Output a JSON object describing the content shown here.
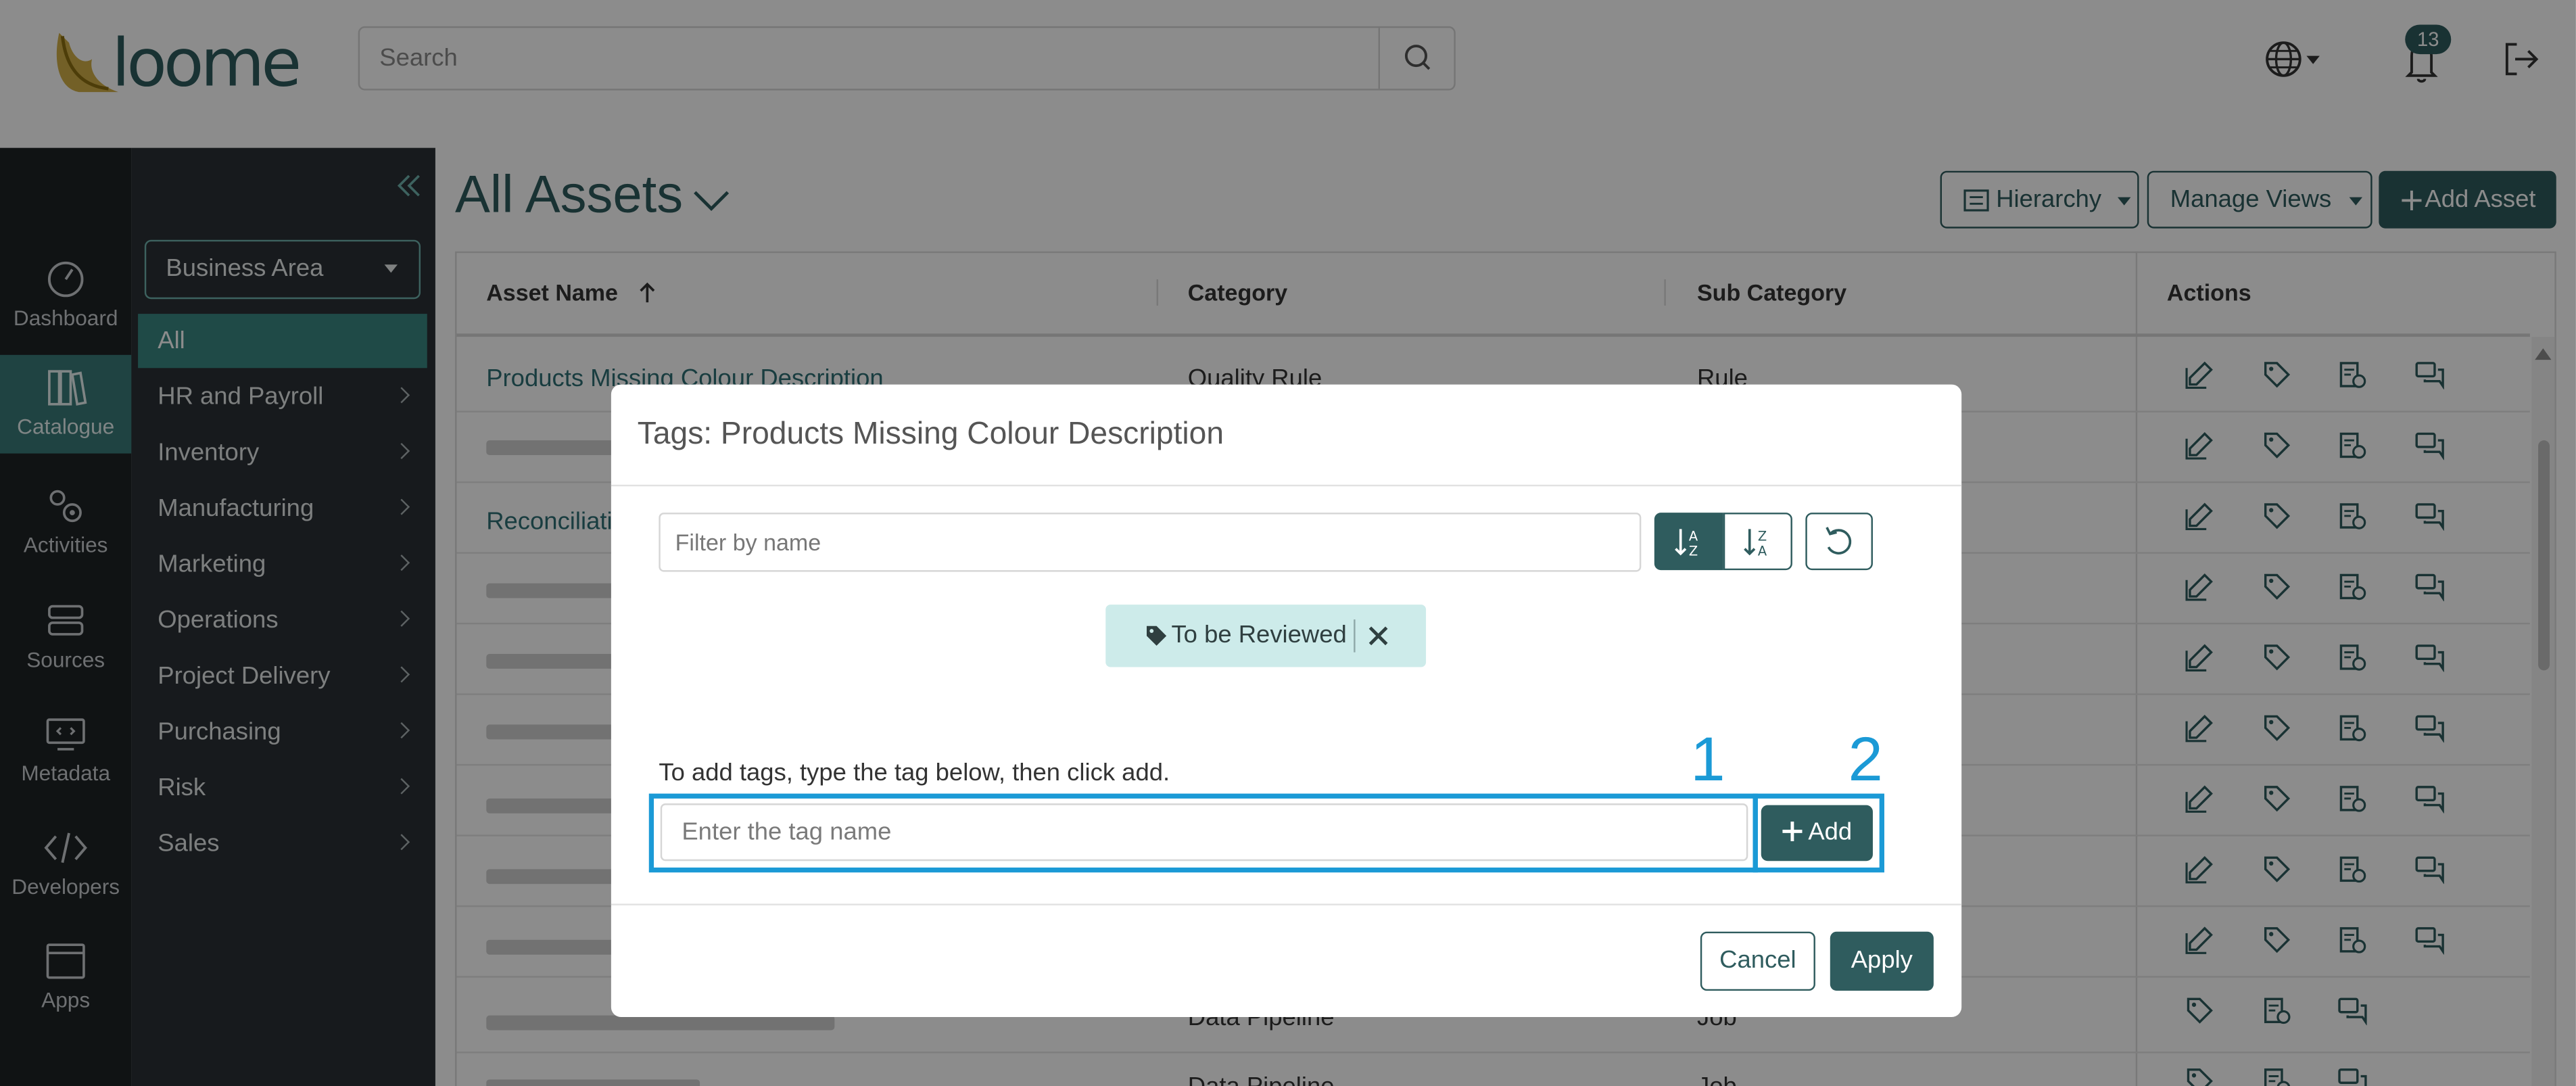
{
  "header": {
    "brand": "loome",
    "search_placeholder": "Search",
    "notification_count": "13",
    "icons": [
      "search-icon",
      "globe-icon",
      "bell-icon",
      "logout-icon"
    ]
  },
  "nav_rail": {
    "items": [
      {
        "label": "Dashboard",
        "icon": "dashboard-icon"
      },
      {
        "label": "Catalogue",
        "icon": "catalogue-icon",
        "active": true
      },
      {
        "label": "Activities",
        "icon": "gears-icon"
      },
      {
        "label": "Sources",
        "icon": "server-icon"
      },
      {
        "label": "Metadata",
        "icon": "monitor-code-icon"
      },
      {
        "label": "Developers",
        "icon": "code-icon"
      },
      {
        "label": "Apps",
        "icon": "window-icon"
      }
    ]
  },
  "category_panel": {
    "filter_select": "Business Area",
    "items": [
      {
        "label": "All",
        "active": true
      },
      {
        "label": "HR and Payroll"
      },
      {
        "label": "Inventory"
      },
      {
        "label": "Manufacturing"
      },
      {
        "label": "Marketing"
      },
      {
        "label": "Operations"
      },
      {
        "label": "Project Delivery"
      },
      {
        "label": "Purchasing"
      },
      {
        "label": "Risk"
      },
      {
        "label": "Sales"
      }
    ]
  },
  "main": {
    "title": "All Assets",
    "buttons": {
      "hierarchy": "Hierarchy",
      "manage_views": "Manage Views",
      "add_asset": "Add Asset"
    },
    "table": {
      "columns": [
        "Asset Name",
        "Category",
        "Sub Category",
        "Actions"
      ],
      "rows": [
        {
          "name": "Products Missing Colour Description",
          "category": "Quality Rule",
          "sub_category": "Rule"
        },
        {
          "name": "",
          "category": "",
          "sub_category": ""
        },
        {
          "name": "Reconciliati",
          "category": "",
          "sub_category": ""
        },
        {
          "name": "",
          "category": "",
          "sub_category": ""
        },
        {
          "name": "",
          "category": "",
          "sub_category": ""
        },
        {
          "name": "",
          "category": "",
          "sub_category": ""
        },
        {
          "name": "",
          "category": "",
          "sub_category": ""
        },
        {
          "name": "",
          "category": "",
          "sub_category": ""
        },
        {
          "name": "",
          "category": "",
          "sub_category": ""
        },
        {
          "name": "",
          "category": "Data Pipeline",
          "sub_category": "Job"
        },
        {
          "name": "",
          "category": "Data Pipeline",
          "sub_category": "Job"
        }
      ]
    }
  },
  "modal": {
    "title": "Tags: Products Missing Colour Description",
    "filter_placeholder": "Filter by name",
    "tags": [
      "To be Reviewed"
    ],
    "helper_text": "To add tags, type the tag below, then click add.",
    "tag_input_placeholder": "Enter the tag name",
    "add_label": "Add",
    "cancel_label": "Cancel",
    "apply_label": "Apply",
    "annotations": [
      "1",
      "2"
    ],
    "highlight_color": "#1b9ad6"
  },
  "colors": {
    "brand_teal": "#2f5c5e",
    "sidebar_dark": "#1e2326",
    "active_teal": "#3a8782",
    "chip_bg": "#cdebea"
  }
}
